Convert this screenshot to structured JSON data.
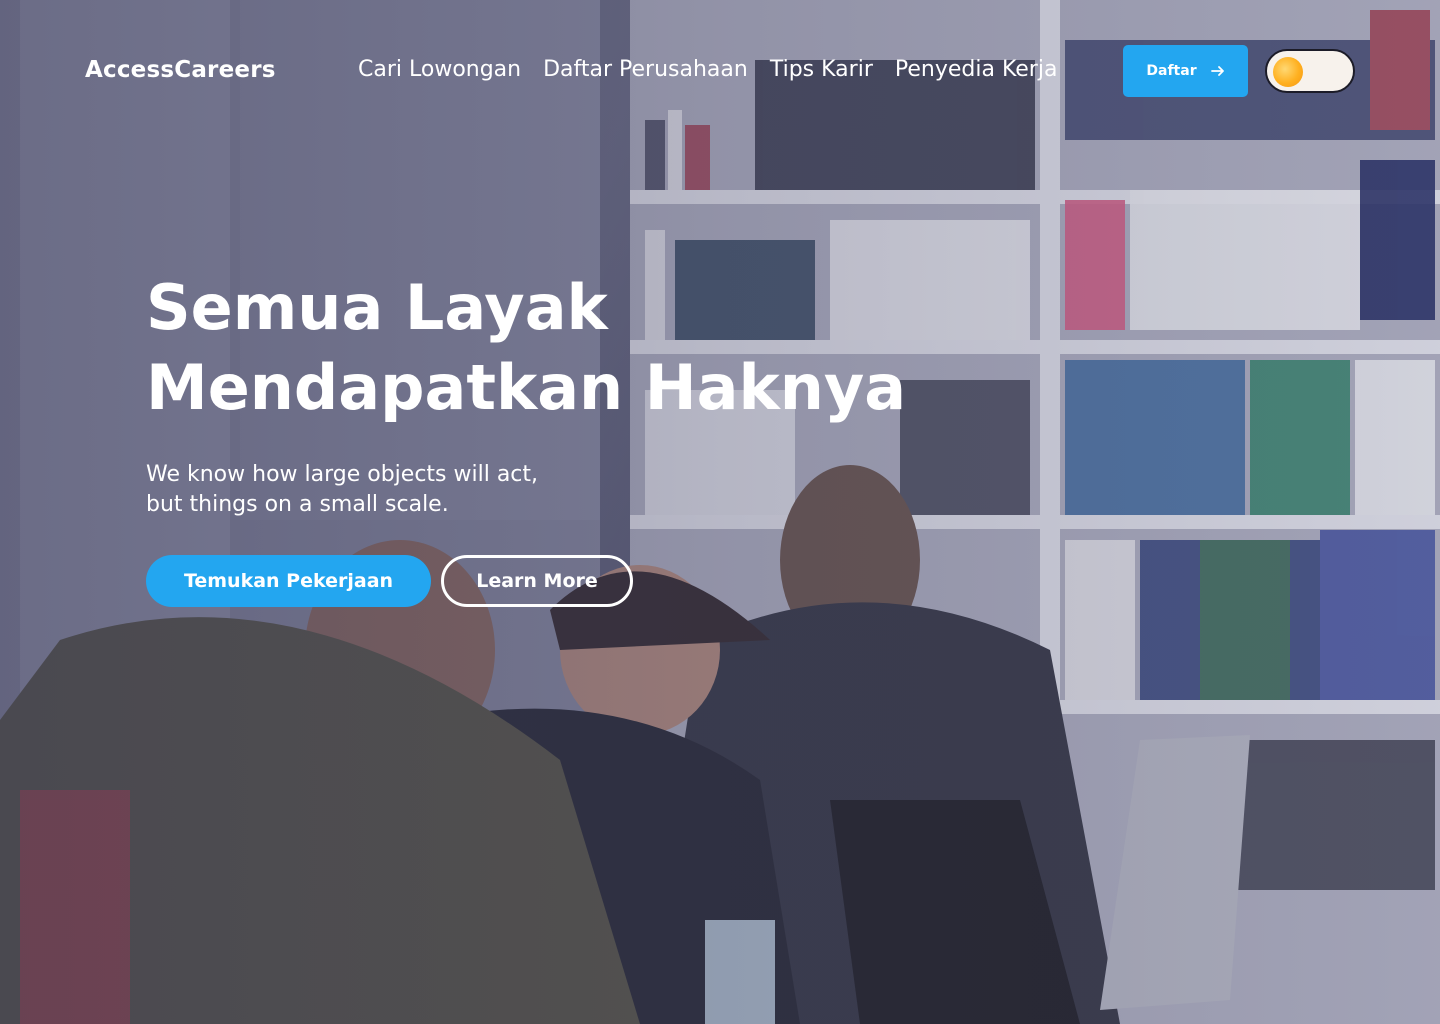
{
  "brand": {
    "name": "AccessCareers"
  },
  "nav": {
    "items": [
      {
        "label": "Cari Lowongan"
      },
      {
        "label": "Daftar Perusahaan"
      },
      {
        "label": "Tips Karir"
      },
      {
        "label": "Penyedia Kerja"
      }
    ]
  },
  "header": {
    "register_label": "Daftar",
    "register_icon": "arrow-right-icon",
    "theme_toggle_icon": "sun-icon"
  },
  "hero": {
    "title_line1": "Semua Layak",
    "title_line2": "Mendapatkan Haknya",
    "subtitle_line1": "We know how large objects will act,",
    "subtitle_line2": "but things on a small scale.",
    "primary_cta": "Temukan Pekerjaan",
    "secondary_cta": "Learn More",
    "background_image": "students laughing at laptops in a library"
  },
  "colors": {
    "accent": "#23a6f0",
    "text": "#ffffff",
    "overlay": "#343452"
  }
}
